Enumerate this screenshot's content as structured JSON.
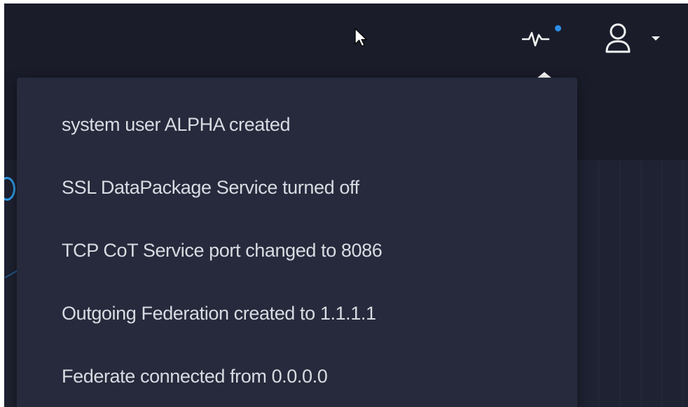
{
  "header": {
    "icons": {
      "activity": "activity-pulse-icon",
      "notification_dot": "notification-dot",
      "user": "user-icon",
      "caret": "caret-down-icon"
    },
    "colors": {
      "header_bg": "#1a1c2a",
      "dropdown_bg": "#262a3c",
      "notification_dot": "#2d8de6",
      "item_text": "#d9dbe2"
    }
  },
  "activity_dropdown": {
    "items": [
      {
        "label": "system user ALPHA created"
      },
      {
        "label": "SSL DataPackage Service turned off"
      },
      {
        "label": "TCP CoT Service port changed to 8086"
      },
      {
        "label": "Outgoing Federation created to 1.1.1.1"
      },
      {
        "label": "Federate connected from 0.0.0.0"
      }
    ]
  }
}
